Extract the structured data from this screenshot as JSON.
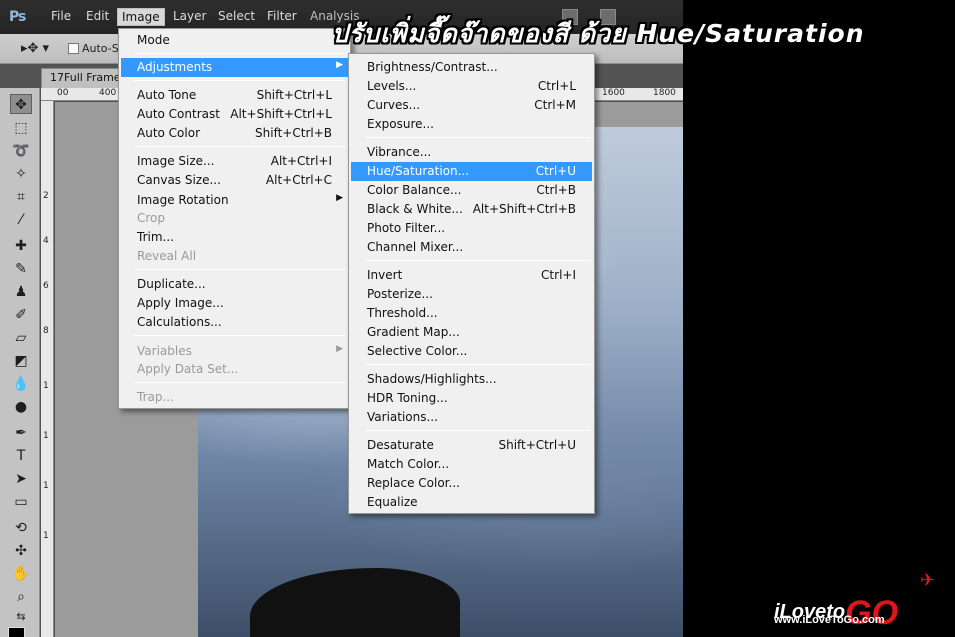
{
  "app": {
    "logo": "Ps"
  },
  "menubar": {
    "items": [
      {
        "id": "file",
        "label": "File"
      },
      {
        "id": "edit",
        "label": "Edit"
      },
      {
        "id": "image",
        "label": "Image"
      },
      {
        "id": "layer",
        "label": "Layer"
      },
      {
        "id": "select",
        "label": "Select"
      },
      {
        "id": "filter",
        "label": "Filter"
      },
      {
        "id": "analysis",
        "label": "Analysis"
      }
    ]
  },
  "options_bar": {
    "tool_glyph": "▸✥ ▾",
    "auto_select_label": "Auto-Se"
  },
  "document": {
    "tab_title": "17Full Frame"
  },
  "rulers": {
    "top": [
      "00",
      "400",
      "1600",
      "1800"
    ],
    "left": [
      "2",
      "4",
      "6",
      "8",
      "1",
      "1",
      "1",
      "1"
    ]
  },
  "image_menu": {
    "items": [
      {
        "label": "Mode",
        "shortcut": "",
        "submenu": false,
        "state": "normal"
      },
      {
        "label": "Adjustments",
        "shortcut": "",
        "submenu": true,
        "state": "highlighted"
      },
      {
        "label": "Auto Tone",
        "shortcut": "Shift+Ctrl+L",
        "submenu": false,
        "state": "normal"
      },
      {
        "label": "Auto Contrast",
        "shortcut": "Alt+Shift+Ctrl+L",
        "submenu": false,
        "state": "normal"
      },
      {
        "label": "Auto Color",
        "shortcut": "Shift+Ctrl+B",
        "submenu": false,
        "state": "normal"
      },
      {
        "label": "Image Size...",
        "shortcut": "Alt+Ctrl+I",
        "submenu": false,
        "state": "normal"
      },
      {
        "label": "Canvas Size...",
        "shortcut": "Alt+Ctrl+C",
        "submenu": false,
        "state": "normal"
      },
      {
        "label": "Image Rotation",
        "shortcut": "",
        "submenu": true,
        "state": "normal"
      },
      {
        "label": "Crop",
        "shortcut": "",
        "submenu": false,
        "state": "disabled"
      },
      {
        "label": "Trim...",
        "shortcut": "",
        "submenu": false,
        "state": "normal"
      },
      {
        "label": "Reveal All",
        "shortcut": "",
        "submenu": false,
        "state": "disabled"
      },
      {
        "label": "Duplicate...",
        "shortcut": "",
        "submenu": false,
        "state": "normal"
      },
      {
        "label": "Apply Image...",
        "shortcut": "",
        "submenu": false,
        "state": "normal"
      },
      {
        "label": "Calculations...",
        "shortcut": "",
        "submenu": false,
        "state": "normal"
      },
      {
        "label": "Variables",
        "shortcut": "",
        "submenu": true,
        "state": "disabled"
      },
      {
        "label": "Apply Data Set...",
        "shortcut": "",
        "submenu": false,
        "state": "disabled"
      },
      {
        "label": "Trap...",
        "shortcut": "",
        "submenu": false,
        "state": "disabled"
      }
    ]
  },
  "adjustments_menu": {
    "items": [
      {
        "label": "Brightness/Contrast...",
        "shortcut": "",
        "state": "normal"
      },
      {
        "label": "Levels...",
        "shortcut": "Ctrl+L",
        "state": "normal"
      },
      {
        "label": "Curves...",
        "shortcut": "Ctrl+M",
        "state": "normal"
      },
      {
        "label": "Exposure...",
        "shortcut": "",
        "state": "normal"
      },
      {
        "label": "Vibrance...",
        "shortcut": "",
        "state": "normal"
      },
      {
        "label": "Hue/Saturation...",
        "shortcut": "Ctrl+U",
        "state": "highlighted"
      },
      {
        "label": "Color Balance...",
        "shortcut": "Ctrl+B",
        "state": "normal"
      },
      {
        "label": "Black & White...",
        "shortcut": "Alt+Shift+Ctrl+B",
        "state": "normal"
      },
      {
        "label": "Photo Filter...",
        "shortcut": "",
        "state": "normal"
      },
      {
        "label": "Channel Mixer...",
        "shortcut": "",
        "state": "normal"
      },
      {
        "label": "Invert",
        "shortcut": "Ctrl+I",
        "state": "normal"
      },
      {
        "label": "Posterize...",
        "shortcut": "",
        "state": "normal"
      },
      {
        "label": "Threshold...",
        "shortcut": "",
        "state": "normal"
      },
      {
        "label": "Gradient Map...",
        "shortcut": "",
        "state": "normal"
      },
      {
        "label": "Selective Color...",
        "shortcut": "",
        "state": "normal"
      },
      {
        "label": "Shadows/Highlights...",
        "shortcut": "",
        "state": "normal"
      },
      {
        "label": "HDR Toning...",
        "shortcut": "",
        "state": "normal"
      },
      {
        "label": "Variations...",
        "shortcut": "",
        "state": "normal"
      },
      {
        "label": "Desaturate",
        "shortcut": "Shift+Ctrl+U",
        "state": "normal"
      },
      {
        "label": "Match Color...",
        "shortcut": "",
        "state": "normal"
      },
      {
        "label": "Replace Color...",
        "shortcut": "",
        "state": "normal"
      },
      {
        "label": "Equalize",
        "shortcut": "",
        "state": "normal"
      }
    ]
  },
  "overlay": {
    "title": "ปรับเพิ่มจี๊ดจ๊าดของสี ด้วย Hue/Saturation"
  },
  "branding": {
    "logo_text": "iLoveto",
    "logo_go": "GO",
    "url": "www.iLoveToGo.com"
  },
  "colors": {
    "menu_highlight": "#3399ff",
    "brand_red": "#e0141b"
  }
}
